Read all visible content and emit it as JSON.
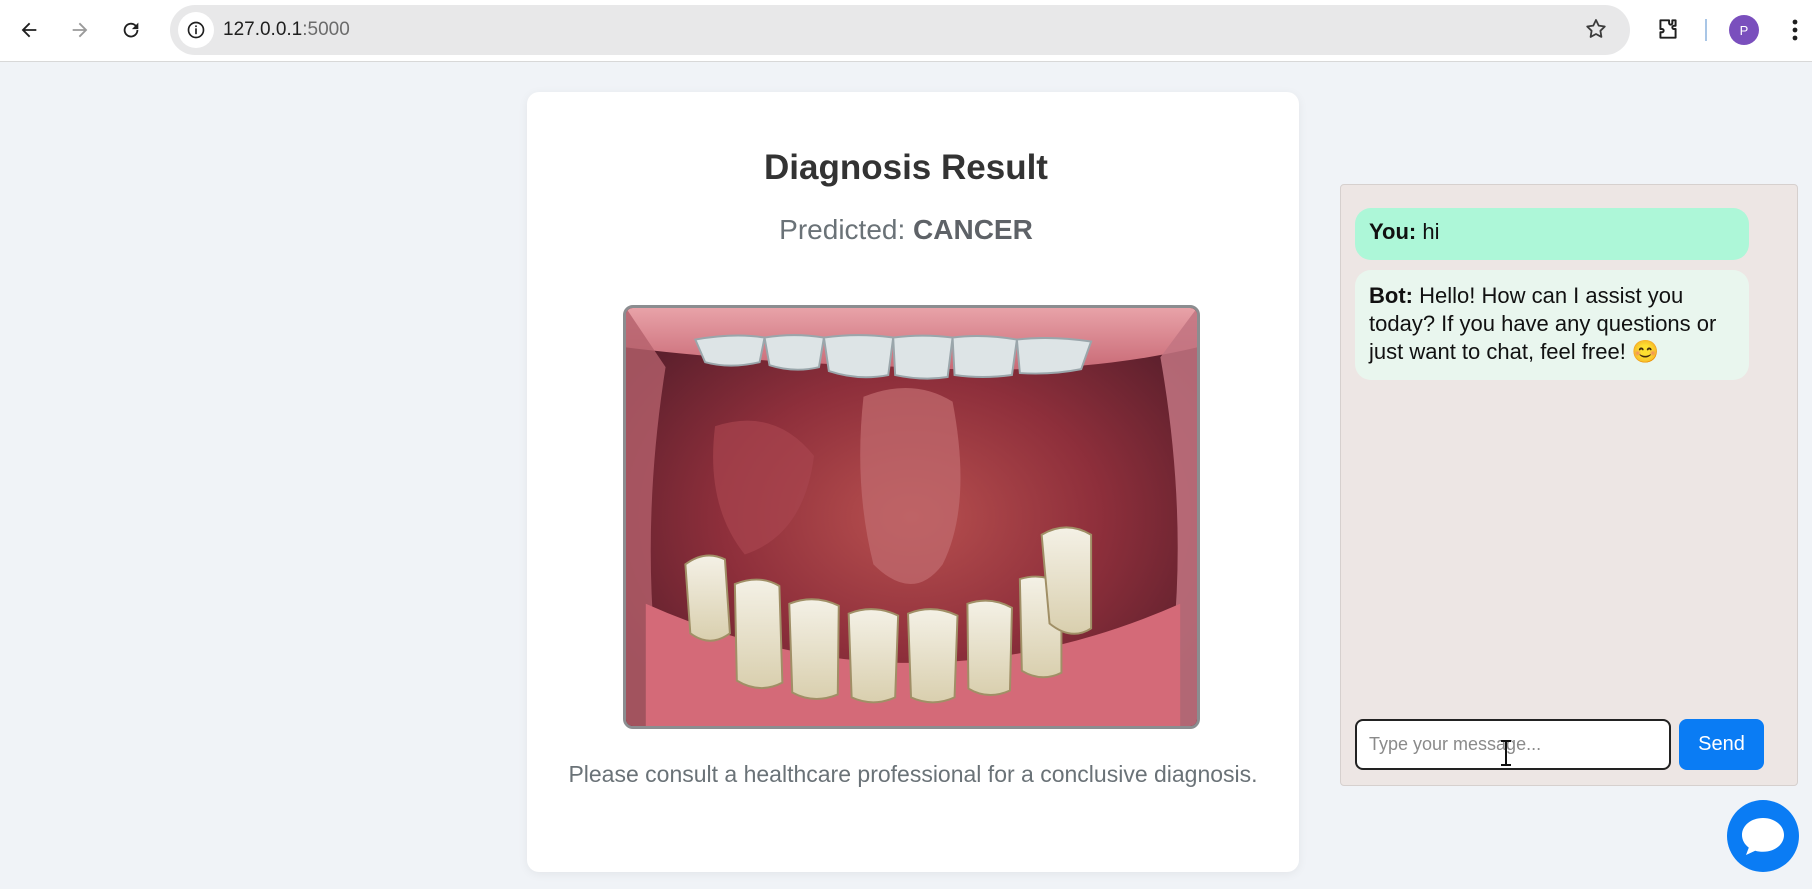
{
  "browser": {
    "url_host": "127.0.0.1",
    "url_port": ":5000",
    "profile_initial": "P",
    "icons": [
      "back-arrow-icon",
      "forward-arrow-icon",
      "reload-icon",
      "site-info-icon",
      "bookmark-star-icon",
      "extensions-icon",
      "kebab-menu-icon"
    ]
  },
  "result": {
    "title": "Diagnosis Result",
    "predicted_label": "Predicted:",
    "predicted_value": "CANCER",
    "disclaimer": "Please consult a healthcare professional for a conclusive diagnosis."
  },
  "chat": {
    "messages": [
      {
        "sender": "You:",
        "text": "hi"
      },
      {
        "sender": "Bot:",
        "text": "Hello! How can I assist you today? If you have any questions or just want to chat, feel free! 😊"
      }
    ],
    "input_placeholder": "Type your message...",
    "send_label": "Send"
  },
  "colors": {
    "page_bg": "#f0f3f7",
    "accent": "#0a7cf4",
    "user_bubble": "#adf7d8",
    "bot_bubble": "#e9f6ee",
    "chat_bg": "#ede6e4"
  }
}
